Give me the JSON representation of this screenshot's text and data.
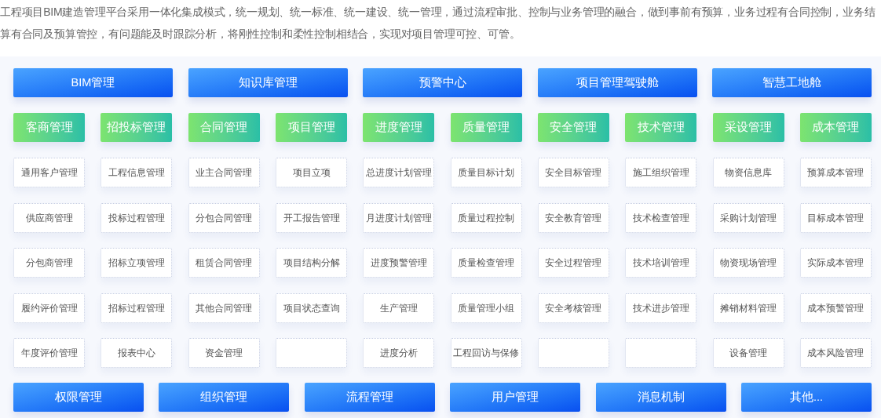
{
  "intro": "工程项目BIM建造管理平台采用一体化集成模式，统一规划、统一标准、统一建设、统一管理，通过流程审批、控制与业务管理的融合，做到事前有预算，业务过程有合同控制，业务结算有合同及预算管控，有问题能及时跟踪分析，将刚性控制和柔性控制相结合，实现对项目管理可控、可管。",
  "platform_modules": [
    "BIM管理",
    "知识库管理",
    "预警中心",
    "项目管理驾驶舱",
    "智慧工地舱"
  ],
  "business_categories": [
    {
      "label": "客商管理",
      "modules": [
        {
          "kind": "module",
          "label": "通用客户管理"
        },
        {
          "kind": "module",
          "label": "供应商管理"
        },
        {
          "kind": "module",
          "label": "分包商管理"
        },
        {
          "kind": "module",
          "label": "履约评价管理"
        },
        {
          "kind": "module",
          "label": "年度评价管理"
        }
      ]
    },
    {
      "label": "招投标管理",
      "modules": [
        {
          "kind": "module",
          "label": "工程信息管理"
        },
        {
          "kind": "module",
          "label": "投标过程管理"
        },
        {
          "kind": "module",
          "label": "招标立项管理"
        },
        {
          "kind": "module",
          "label": "招标过程管理"
        },
        {
          "kind": "module",
          "label": "报表中心"
        }
      ]
    },
    {
      "label": "合同管理",
      "modules": [
        {
          "kind": "module",
          "label": "业主合同管理"
        },
        {
          "kind": "module",
          "label": "分包合同管理"
        },
        {
          "kind": "module",
          "label": "租赁合同管理"
        },
        {
          "kind": "module",
          "label": "其他合同管理"
        },
        {
          "kind": "module",
          "label": "资金管理"
        }
      ]
    },
    {
      "label": "项目管理",
      "modules": [
        {
          "kind": "module",
          "label": "项目立项"
        },
        {
          "kind": "module",
          "label": "开工报告管理"
        },
        {
          "kind": "module",
          "label": "项目结构分解"
        },
        {
          "kind": "module",
          "label": "项目状态查询"
        },
        {
          "kind": "empty"
        }
      ]
    },
    {
      "label": "进度管理",
      "modules": [
        {
          "kind": "module",
          "label": "总进度计划管理"
        },
        {
          "kind": "module",
          "label": "月进度计划管理"
        },
        {
          "kind": "module",
          "label": "进度预警管理"
        },
        {
          "kind": "module",
          "label": "生产管理"
        },
        {
          "kind": "module",
          "label": "进度分析"
        }
      ]
    },
    {
      "label": "质量管理",
      "modules": [
        {
          "kind": "module",
          "label": "质量目标计划"
        },
        {
          "kind": "module",
          "label": "质量过程控制"
        },
        {
          "kind": "module",
          "label": "质量检查管理"
        },
        {
          "kind": "module",
          "label": "质量管理小组"
        },
        {
          "kind": "module",
          "label": "工程回访与保修"
        }
      ]
    },
    {
      "label": "安全管理",
      "modules": [
        {
          "kind": "module",
          "label": "安全目标管理"
        },
        {
          "kind": "module",
          "label": "安全教育管理"
        },
        {
          "kind": "module",
          "label": "安全过程管理"
        },
        {
          "kind": "module",
          "label": "安全考核管理"
        },
        {
          "kind": "empty"
        }
      ]
    },
    {
      "label": "技术管理",
      "modules": [
        {
          "kind": "module",
          "label": "施工组织管理"
        },
        {
          "kind": "module",
          "label": "技术检查管理"
        },
        {
          "kind": "module",
          "label": "技术培训管理"
        },
        {
          "kind": "module",
          "label": "技术进步管理"
        },
        {
          "kind": "empty"
        }
      ]
    },
    {
      "label": "采设管理",
      "modules": [
        {
          "kind": "module",
          "label": "物资信息库"
        },
        {
          "kind": "module",
          "label": "采购计划管理"
        },
        {
          "kind": "module",
          "label": "物资现场管理"
        },
        {
          "kind": "module",
          "label": "摊销材料管理"
        },
        {
          "kind": "module",
          "label": "设备管理"
        }
      ]
    },
    {
      "label": "成本管理",
      "modules": [
        {
          "kind": "module",
          "label": "预算成本管理"
        },
        {
          "kind": "module",
          "label": "目标成本管理"
        },
        {
          "kind": "module",
          "label": "实际成本管理"
        },
        {
          "kind": "module",
          "label": "成本预警管理"
        },
        {
          "kind": "module",
          "label": "成本风险管理"
        }
      ]
    }
  ],
  "system_modules": [
    "权限管理",
    "组织管理",
    "流程管理",
    "用户管理",
    "消息机制",
    "其他..."
  ]
}
